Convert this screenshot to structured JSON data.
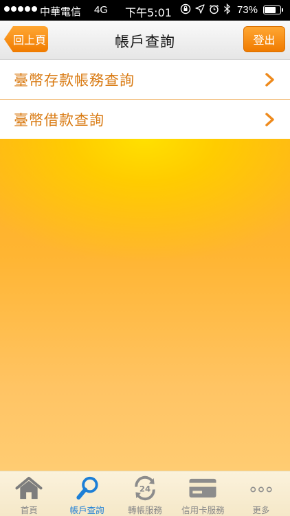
{
  "status_bar": {
    "carrier": "中華電信",
    "network": "4G",
    "time": "下午5:01",
    "battery_percent": "73%",
    "battery_level": 0.73
  },
  "nav": {
    "back_label": "回上頁",
    "title": "帳戶查詢",
    "logout_label": "登出"
  },
  "menu": {
    "items": [
      {
        "label": "臺幣存款帳務查詢"
      },
      {
        "label": "臺幣借款查詢"
      }
    ]
  },
  "tabs": [
    {
      "label": "首頁",
      "icon": "home-icon",
      "active": false
    },
    {
      "label": "帳戶查詢",
      "icon": "search-icon",
      "active": true
    },
    {
      "label": "轉帳服務",
      "icon": "transfer-24-icon",
      "active": false
    },
    {
      "label": "信用卡服務",
      "icon": "credit-card-icon",
      "active": false
    },
    {
      "label": "更多",
      "icon": "more-icon",
      "active": false
    }
  ],
  "colors": {
    "accent_orange": "#f07b00",
    "menu_text": "#d97a12",
    "active_tab": "#1d7fd6",
    "inactive_tab": "#8a8a8a"
  }
}
